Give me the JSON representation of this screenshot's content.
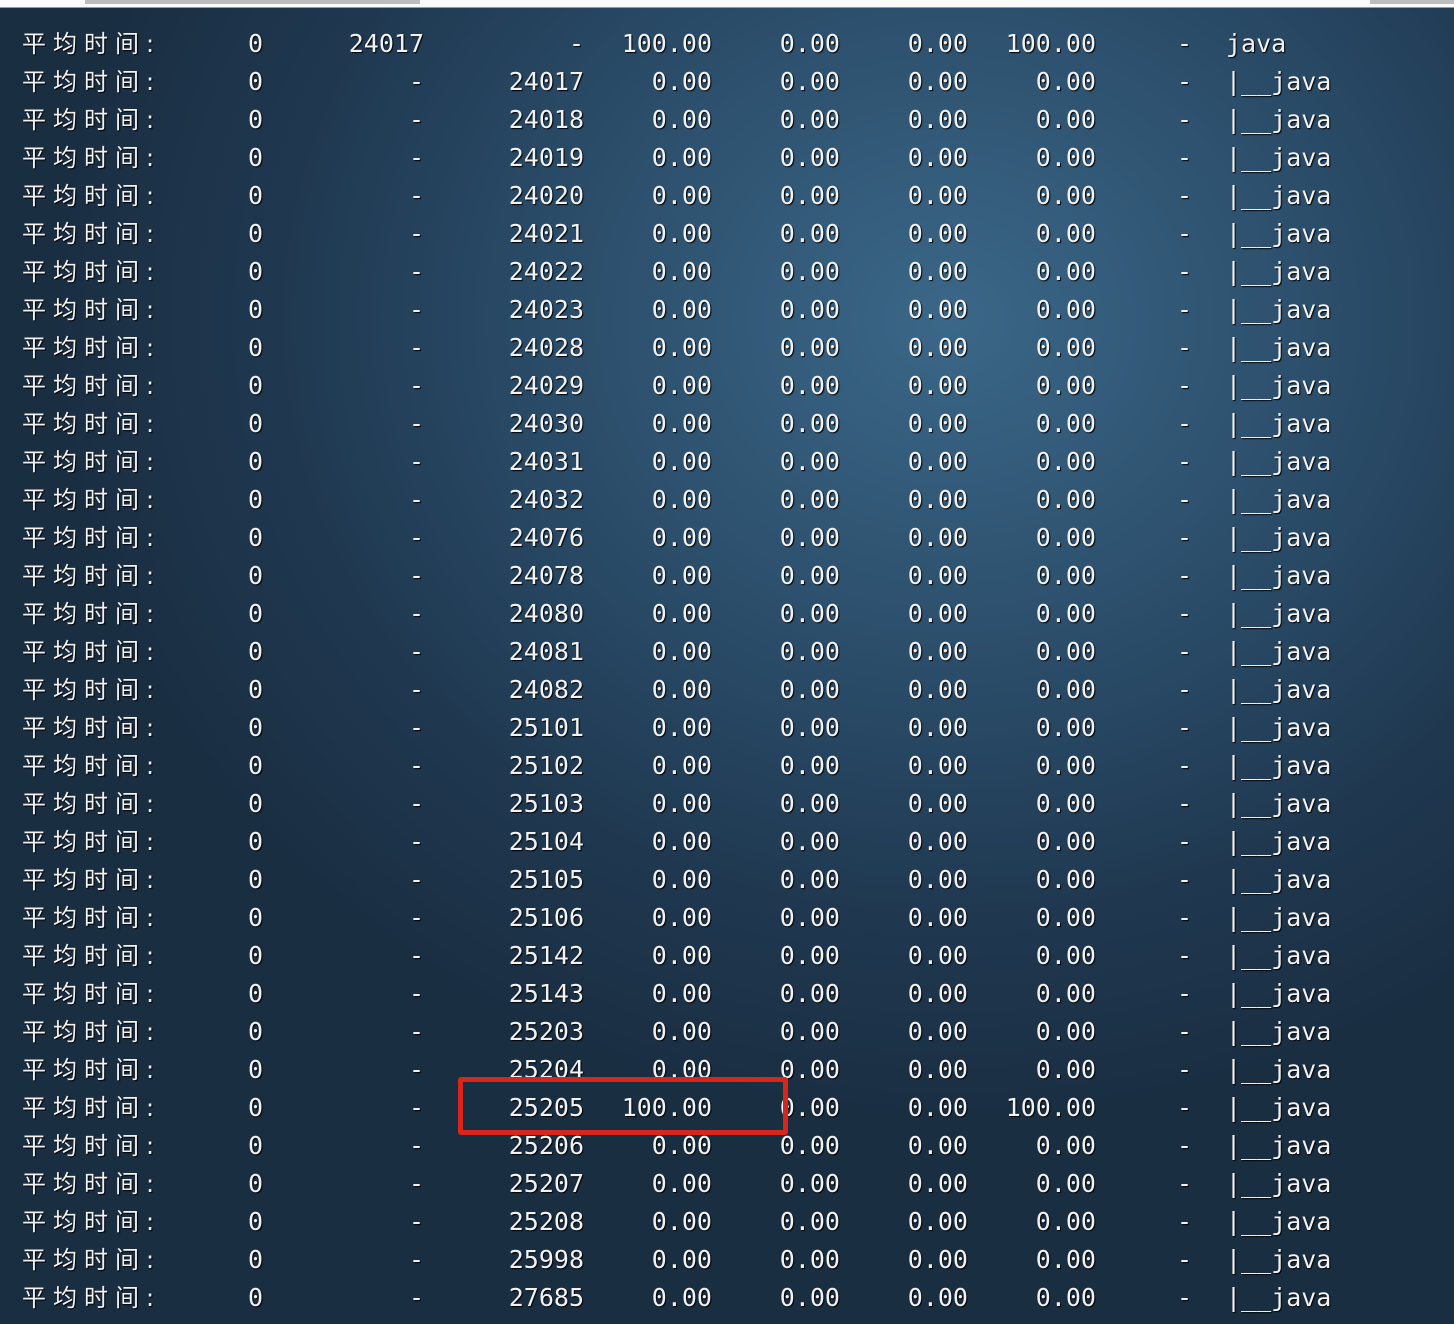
{
  "highlight_color": "#d9261a",
  "rows": [
    [
      "平均时间:",
      "0",
      "24017",
      "-",
      "100.00",
      "0.00",
      "0.00",
      "100.00",
      "-",
      "java"
    ],
    [
      "平均时间:",
      "0",
      "-",
      "24017",
      "0.00",
      "0.00",
      "0.00",
      "0.00",
      "-",
      "|__java"
    ],
    [
      "平均时间:",
      "0",
      "-",
      "24018",
      "0.00",
      "0.00",
      "0.00",
      "0.00",
      "-",
      "|__java"
    ],
    [
      "平均时间:",
      "0",
      "-",
      "24019",
      "0.00",
      "0.00",
      "0.00",
      "0.00",
      "-",
      "|__java"
    ],
    [
      "平均时间:",
      "0",
      "-",
      "24020",
      "0.00",
      "0.00",
      "0.00",
      "0.00",
      "-",
      "|__java"
    ],
    [
      "平均时间:",
      "0",
      "-",
      "24021",
      "0.00",
      "0.00",
      "0.00",
      "0.00",
      "-",
      "|__java"
    ],
    [
      "平均时间:",
      "0",
      "-",
      "24022",
      "0.00",
      "0.00",
      "0.00",
      "0.00",
      "-",
      "|__java"
    ],
    [
      "平均时间:",
      "0",
      "-",
      "24023",
      "0.00",
      "0.00",
      "0.00",
      "0.00",
      "-",
      "|__java"
    ],
    [
      "平均时间:",
      "0",
      "-",
      "24028",
      "0.00",
      "0.00",
      "0.00",
      "0.00",
      "-",
      "|__java"
    ],
    [
      "平均时间:",
      "0",
      "-",
      "24029",
      "0.00",
      "0.00",
      "0.00",
      "0.00",
      "-",
      "|__java"
    ],
    [
      "平均时间:",
      "0",
      "-",
      "24030",
      "0.00",
      "0.00",
      "0.00",
      "0.00",
      "-",
      "|__java"
    ],
    [
      "平均时间:",
      "0",
      "-",
      "24031",
      "0.00",
      "0.00",
      "0.00",
      "0.00",
      "-",
      "|__java"
    ],
    [
      "平均时间:",
      "0",
      "-",
      "24032",
      "0.00",
      "0.00",
      "0.00",
      "0.00",
      "-",
      "|__java"
    ],
    [
      "平均时间:",
      "0",
      "-",
      "24076",
      "0.00",
      "0.00",
      "0.00",
      "0.00",
      "-",
      "|__java"
    ],
    [
      "平均时间:",
      "0",
      "-",
      "24078",
      "0.00",
      "0.00",
      "0.00",
      "0.00",
      "-",
      "|__java"
    ],
    [
      "平均时间:",
      "0",
      "-",
      "24080",
      "0.00",
      "0.00",
      "0.00",
      "0.00",
      "-",
      "|__java"
    ],
    [
      "平均时间:",
      "0",
      "-",
      "24081",
      "0.00",
      "0.00",
      "0.00",
      "0.00",
      "-",
      "|__java"
    ],
    [
      "平均时间:",
      "0",
      "-",
      "24082",
      "0.00",
      "0.00",
      "0.00",
      "0.00",
      "-",
      "|__java"
    ],
    [
      "平均时间:",
      "0",
      "-",
      "25101",
      "0.00",
      "0.00",
      "0.00",
      "0.00",
      "-",
      "|__java"
    ],
    [
      "平均时间:",
      "0",
      "-",
      "25102",
      "0.00",
      "0.00",
      "0.00",
      "0.00",
      "-",
      "|__java"
    ],
    [
      "平均时间:",
      "0",
      "-",
      "25103",
      "0.00",
      "0.00",
      "0.00",
      "0.00",
      "-",
      "|__java"
    ],
    [
      "平均时间:",
      "0",
      "-",
      "25104",
      "0.00",
      "0.00",
      "0.00",
      "0.00",
      "-",
      "|__java"
    ],
    [
      "平均时间:",
      "0",
      "-",
      "25105",
      "0.00",
      "0.00",
      "0.00",
      "0.00",
      "-",
      "|__java"
    ],
    [
      "平均时间:",
      "0",
      "-",
      "25106",
      "0.00",
      "0.00",
      "0.00",
      "0.00",
      "-",
      "|__java"
    ],
    [
      "平均时间:",
      "0",
      "-",
      "25142",
      "0.00",
      "0.00",
      "0.00",
      "0.00",
      "-",
      "|__java"
    ],
    [
      "平均时间:",
      "0",
      "-",
      "25143",
      "0.00",
      "0.00",
      "0.00",
      "0.00",
      "-",
      "|__java"
    ],
    [
      "平均时间:",
      "0",
      "-",
      "25203",
      "0.00",
      "0.00",
      "0.00",
      "0.00",
      "-",
      "|__java"
    ],
    [
      "平均时间:",
      "0",
      "-",
      "25204",
      "0.00",
      "0.00",
      "0.00",
      "0.00",
      "-",
      "|__java"
    ],
    [
      "平均时间:",
      "0",
      "-",
      "25205",
      "100.00",
      "0.00",
      "0.00",
      "100.00",
      "-",
      "|__java"
    ],
    [
      "平均时间:",
      "0",
      "-",
      "25206",
      "0.00",
      "0.00",
      "0.00",
      "0.00",
      "-",
      "|__java"
    ],
    [
      "平均时间:",
      "0",
      "-",
      "25207",
      "0.00",
      "0.00",
      "0.00",
      "0.00",
      "-",
      "|__java"
    ],
    [
      "平均时间:",
      "0",
      "-",
      "25208",
      "0.00",
      "0.00",
      "0.00",
      "0.00",
      "-",
      "|__java"
    ],
    [
      "平均时间:",
      "0",
      "-",
      "25998",
      "0.00",
      "0.00",
      "0.00",
      "0.00",
      "-",
      "|__java"
    ],
    [
      "平均时间:",
      "0",
      "-",
      "27685",
      "0.00",
      "0.00",
      "0.00",
      "0.00",
      "-",
      "|__java"
    ]
  ]
}
